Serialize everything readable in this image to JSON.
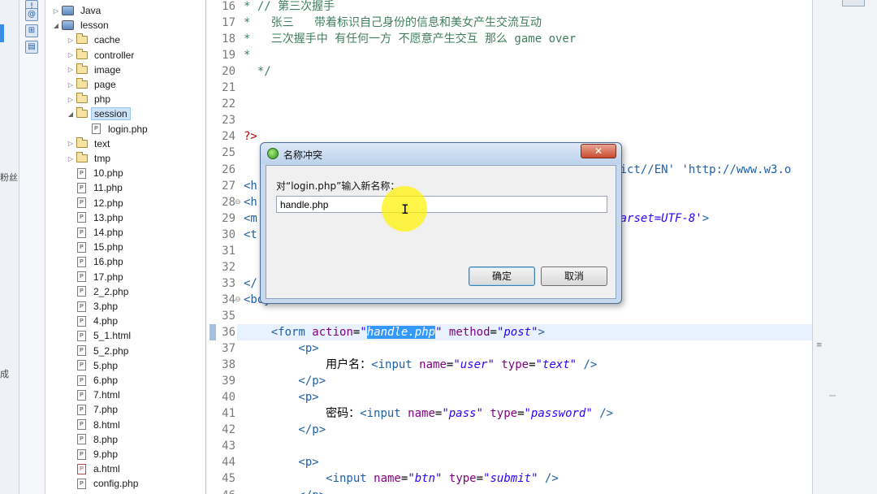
{
  "left_strip": {
    "fragments": [
      "粉丝",
      "成"
    ]
  },
  "explorer": {
    "items": [
      {
        "label": "Java",
        "type": "project",
        "arrow": "▷",
        "depth": 0
      },
      {
        "label": "lesson",
        "type": "project",
        "arrow": "◢",
        "depth": 0
      },
      {
        "label": "cache",
        "type": "folder",
        "arrow": "▷",
        "depth": 1
      },
      {
        "label": "controller",
        "type": "folder",
        "arrow": "▷",
        "depth": 1
      },
      {
        "label": "image",
        "type": "folder",
        "arrow": "▷",
        "depth": 1
      },
      {
        "label": "page",
        "type": "folder",
        "arrow": "▷",
        "depth": 1
      },
      {
        "label": "php",
        "type": "folder",
        "arrow": "▷",
        "depth": 1
      },
      {
        "label": "session",
        "type": "folder",
        "arrow": "◢",
        "depth": 1,
        "selected": true
      },
      {
        "label": "login.php",
        "type": "file",
        "arrow": "",
        "depth": 2
      },
      {
        "label": "text",
        "type": "folder",
        "arrow": "▷",
        "depth": 1
      },
      {
        "label": "tmp",
        "type": "folder",
        "arrow": "▷",
        "depth": 1
      },
      {
        "label": "10.php",
        "type": "file",
        "arrow": "",
        "depth": 1
      },
      {
        "label": "11.php",
        "type": "file",
        "arrow": "",
        "depth": 1
      },
      {
        "label": "12.php",
        "type": "file",
        "arrow": "",
        "depth": 1
      },
      {
        "label": "13.php",
        "type": "file",
        "arrow": "",
        "depth": 1
      },
      {
        "label": "14.php",
        "type": "file",
        "arrow": "",
        "depth": 1
      },
      {
        "label": "15.php",
        "type": "file",
        "arrow": "",
        "depth": 1
      },
      {
        "label": "16.php",
        "type": "file",
        "arrow": "",
        "depth": 1
      },
      {
        "label": "17.php",
        "type": "file",
        "arrow": "",
        "depth": 1
      },
      {
        "label": "2_2.php",
        "type": "file",
        "arrow": "",
        "depth": 1
      },
      {
        "label": "3.php",
        "type": "file",
        "arrow": "",
        "depth": 1
      },
      {
        "label": "4.php",
        "type": "file",
        "arrow": "",
        "depth": 1
      },
      {
        "label": "5_1.html",
        "type": "file",
        "arrow": "",
        "depth": 1
      },
      {
        "label": "5_2.php",
        "type": "file",
        "arrow": "",
        "depth": 1
      },
      {
        "label": "5.php",
        "type": "file",
        "arrow": "",
        "depth": 1
      },
      {
        "label": "6.php",
        "type": "file",
        "arrow": "",
        "depth": 1
      },
      {
        "label": "7.html",
        "type": "file",
        "arrow": "",
        "depth": 1
      },
      {
        "label": "7.php",
        "type": "file",
        "arrow": "",
        "depth": 1
      },
      {
        "label": "8.html",
        "type": "file",
        "arrow": "",
        "depth": 1
      },
      {
        "label": "8.php",
        "type": "file",
        "arrow": "",
        "depth": 1
      },
      {
        "label": "9.php",
        "type": "file",
        "arrow": "",
        "depth": 1
      },
      {
        "label": "a.html",
        "type": "file-html",
        "arrow": "",
        "depth": 1
      },
      {
        "label": "config.php",
        "type": "file",
        "arrow": "",
        "depth": 1
      }
    ]
  },
  "editor": {
    "lines": [
      {
        "num": "16",
        "fold": "",
        "segments": [
          {
            "t": "* // 第三次握手",
            "c": "c-comment"
          }
        ]
      },
      {
        "num": "17",
        "fold": "",
        "segments": [
          {
            "t": "*   张三   带着标识自己身份的信息和美女产生交流互动",
            "c": "c-comment"
          }
        ]
      },
      {
        "num": "18",
        "fold": "",
        "segments": [
          {
            "t": "*   三次握手中 有任何一方 不愿意产生交互 那么 game over",
            "c": "c-comment"
          }
        ]
      },
      {
        "num": "19",
        "fold": "",
        "segments": [
          {
            "t": "*",
            "c": "c-comment"
          }
        ]
      },
      {
        "num": "20",
        "fold": "",
        "segments": [
          {
            "t": "  */",
            "c": "c-comment"
          }
        ]
      },
      {
        "num": "21",
        "fold": "",
        "segments": []
      },
      {
        "num": "22",
        "fold": "",
        "segments": []
      },
      {
        "num": "23",
        "fold": "",
        "segments": []
      },
      {
        "num": "24",
        "fold": "",
        "segments": [
          {
            "t": "?>",
            "c": "c-php"
          }
        ]
      },
      {
        "num": "25",
        "fold": "",
        "segments": []
      },
      {
        "num": "26",
        "fold": "",
        "segments": [
          {
            "t": "                                                      rict//EN' 'http://www.w3.o",
            "c": "c-tag"
          }
        ]
      },
      {
        "num": "27",
        "fold": "",
        "segments": [
          {
            "t": "<h",
            "c": "c-tag"
          }
        ]
      },
      {
        "num": "28",
        "fold": "⊖",
        "segments": [
          {
            "t": "<h",
            "c": "c-tag"
          }
        ]
      },
      {
        "num": "29",
        "fold": "",
        "segments": [
          {
            "t": "<m",
            "c": "c-tag"
          },
          {
            "t": "                                                   charset=UTF-8'",
            "c": "c-val"
          },
          {
            "t": ">",
            "c": "c-tag"
          }
        ]
      },
      {
        "num": "30",
        "fold": "",
        "segments": [
          {
            "t": "<t",
            "c": "c-tag"
          }
        ]
      },
      {
        "num": "31",
        "fold": "",
        "segments": []
      },
      {
        "num": "32",
        "fold": "",
        "segments": []
      },
      {
        "num": "33",
        "fold": "",
        "segments": [
          {
            "t": "</",
            "c": "c-tag"
          }
        ]
      },
      {
        "num": "34",
        "fold": "⊖",
        "segments": [
          {
            "t": "<bo",
            "c": "c-tag"
          },
          {
            "t": "y>",
            "c": "c-tag"
          }
        ]
      },
      {
        "num": "35",
        "fold": "",
        "segments": []
      },
      {
        "num": "36",
        "fold": "",
        "current": true,
        "segments": [
          {
            "t": "    <",
            "c": "c-tag"
          },
          {
            "t": "form",
            "c": "c-tag"
          },
          {
            "t": " action",
            "c": "c-attr"
          },
          {
            "t": "=",
            "c": ""
          },
          {
            "t": "\"",
            "c": "c-val"
          },
          {
            "t": "handle.php",
            "c": "c-sel"
          },
          {
            "t": "\"",
            "c": "c-val"
          },
          {
            "t": " method",
            "c": "c-attr"
          },
          {
            "t": "=",
            "c": ""
          },
          {
            "t": "\"post\"",
            "c": "c-val"
          },
          {
            "t": ">",
            "c": "c-tag"
          }
        ]
      },
      {
        "num": "37",
        "fold": "",
        "segments": [
          {
            "t": "        <p>",
            "c": "c-tag"
          }
        ]
      },
      {
        "num": "38",
        "fold": "",
        "segments": [
          {
            "t": "            用户名：",
            "c": ""
          },
          {
            "t": "<input",
            "c": "c-tag"
          },
          {
            "t": " name",
            "c": "c-attr"
          },
          {
            "t": "=",
            "c": ""
          },
          {
            "t": "\"user\"",
            "c": "c-val"
          },
          {
            "t": " type",
            "c": "c-attr"
          },
          {
            "t": "=",
            "c": ""
          },
          {
            "t": "\"text\"",
            "c": "c-val"
          },
          {
            "t": " />",
            "c": "c-tag"
          }
        ]
      },
      {
        "num": "39",
        "fold": "",
        "segments": [
          {
            "t": "        </p>",
            "c": "c-tag"
          }
        ]
      },
      {
        "num": "40",
        "fold": "",
        "segments": [
          {
            "t": "        <p>",
            "c": "c-tag"
          }
        ]
      },
      {
        "num": "41",
        "fold": "",
        "segments": [
          {
            "t": "            密码：",
            "c": ""
          },
          {
            "t": "<input",
            "c": "c-tag"
          },
          {
            "t": " name",
            "c": "c-attr"
          },
          {
            "t": "=",
            "c": ""
          },
          {
            "t": "\"pass\"",
            "c": "c-val"
          },
          {
            "t": " type",
            "c": "c-attr"
          },
          {
            "t": "=",
            "c": ""
          },
          {
            "t": "\"password\"",
            "c": "c-val"
          },
          {
            "t": " />",
            "c": "c-tag"
          }
        ]
      },
      {
        "num": "42",
        "fold": "",
        "segments": [
          {
            "t": "        </p>",
            "c": "c-tag"
          }
        ]
      },
      {
        "num": "43",
        "fold": "",
        "segments": []
      },
      {
        "num": "44",
        "fold": "",
        "segments": [
          {
            "t": "        <p>",
            "c": "c-tag"
          }
        ]
      },
      {
        "num": "45",
        "fold": "",
        "segments": [
          {
            "t": "            <input",
            "c": "c-tag"
          },
          {
            "t": " name",
            "c": "c-attr"
          },
          {
            "t": "=",
            "c": ""
          },
          {
            "t": "\"btn\"",
            "c": "c-val"
          },
          {
            "t": " type",
            "c": "c-attr"
          },
          {
            "t": "=",
            "c": ""
          },
          {
            "t": "\"submit\"",
            "c": "c-val"
          },
          {
            "t": " />",
            "c": "c-tag"
          }
        ]
      },
      {
        "num": "46",
        "fold": "",
        "segments": [
          {
            "t": "        </p>",
            "c": "c-tag"
          }
        ]
      }
    ]
  },
  "dialog": {
    "title": "名称冲突",
    "close_label": "✕",
    "prompt": "对“login.php”输入新名称：",
    "input_value": "handle.php",
    "ok_label": "确定",
    "cancel_label": "取消"
  },
  "colors": {
    "selection": "#3399ff",
    "current_line": "#e8f2fe",
    "cursor_highlight": "#fff300"
  }
}
